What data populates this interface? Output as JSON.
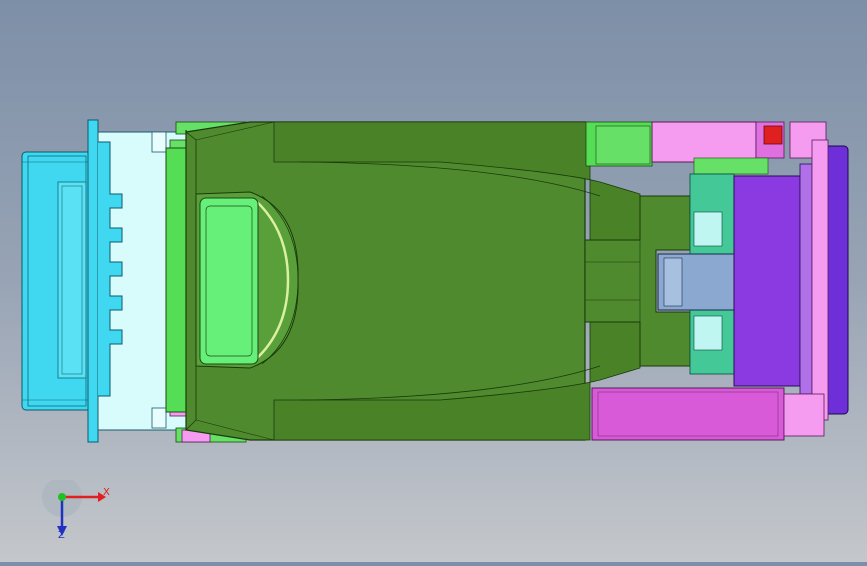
{
  "viewport": {
    "background_top": "#7d8fa7",
    "background_bottom": "#c4c7cb"
  },
  "model": {
    "colors": {
      "body_green": "#4f8a2e",
      "body_dark": "#3a6a1e",
      "connector_cyan": "#40d8f0",
      "connector_light": "#d8fbfb",
      "pane_green": "#66f07a",
      "bright_green": "#55dd55",
      "pink": "#f59cf0",
      "magenta": "#d85ad8",
      "purple": "#8a3ae0",
      "violet": "#6e2ed8",
      "steel_blue": "#8aa8d0",
      "red": "#e02020"
    }
  },
  "triad": {
    "x_label": "X",
    "z_label": "Z",
    "x_color": "#e02020",
    "y_color": "#20c020",
    "z_color": "#2030c0"
  }
}
